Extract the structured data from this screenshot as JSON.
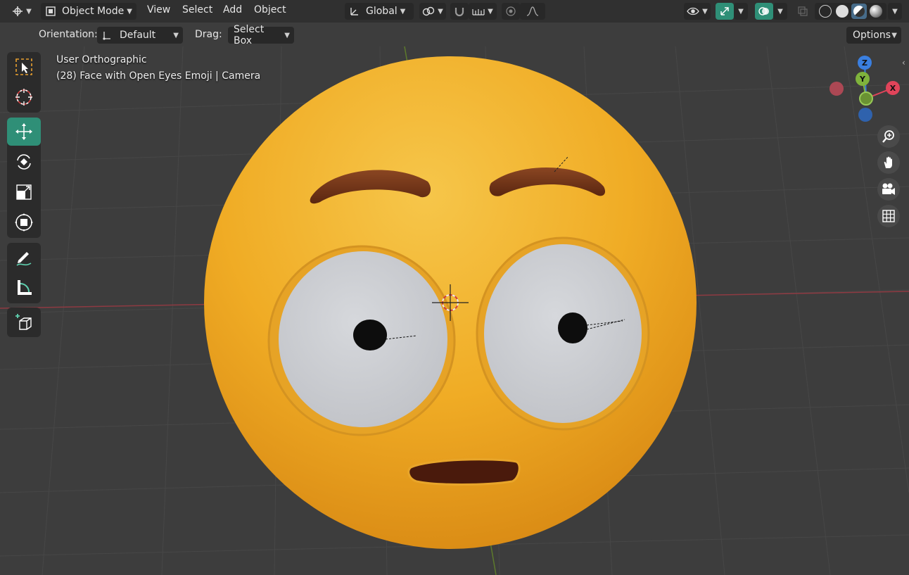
{
  "header": {
    "editor_type_icon": "cursor-icon",
    "mode_label": "Object Mode",
    "menus": [
      "View",
      "Select",
      "Add",
      "Object"
    ],
    "transform_orientation": "Global",
    "icons": {
      "pivot": "pivot-link-icon",
      "snap": "snap-magnet-icon",
      "snap_target": "snap-increment-icon",
      "proportional": "proportional-edit-icon",
      "falloff": "falloff-curve-icon",
      "visibility": "eye-icon",
      "gizmo": "gizmo-arrow-icon",
      "overlays": "overlays-icon",
      "xray": "xray-icon",
      "shading_wire": "wireframe-shading-icon",
      "shading_solid": "solid-shading-icon",
      "shading_material": "material-shading-icon",
      "shading_rendered": "rendered-shading-icon"
    }
  },
  "tool_settings": {
    "orientation_label": "Orientation:",
    "orientation_value": "Default",
    "drag_label": "Drag:",
    "drag_value": "Select Box",
    "options_label": "Options"
  },
  "viewport": {
    "view_name": "User Orthographic",
    "object_info": "(28) Face with Open Eyes Emoji | Camera"
  },
  "toolbar": {
    "tools": [
      {
        "name": "select-box",
        "icon": "select-box-icon",
        "active": false
      },
      {
        "name": "cursor",
        "icon": "cursor-target-icon",
        "active": false
      },
      {
        "name": "move",
        "icon": "move-icon",
        "active": true
      },
      {
        "name": "rotate",
        "icon": "rotate-icon",
        "active": false
      },
      {
        "name": "scale",
        "icon": "scale-icon",
        "active": false
      },
      {
        "name": "transform",
        "icon": "transform-icon",
        "active": false
      },
      {
        "name": "annotate",
        "icon": "annotate-pen-icon",
        "active": false
      },
      {
        "name": "measure",
        "icon": "measure-ruler-icon",
        "active": false
      },
      {
        "name": "add-cube",
        "icon": "add-cube-icon",
        "active": false
      }
    ]
  },
  "navigation": {
    "gizmo_axes": [
      "Z",
      "Y",
      "X"
    ],
    "axis_colors": {
      "x": "#e0445a",
      "y": "#7fb33c",
      "z": "#3a7fe0"
    },
    "buttons": [
      "zoom-icon",
      "hand-pan-icon",
      "camera-icon",
      "grid-icon"
    ]
  },
  "theme": {
    "accent_teal": "#2f8f77",
    "emoji_yellow": "#f2b42b",
    "brow_brown": "#6e3218"
  }
}
